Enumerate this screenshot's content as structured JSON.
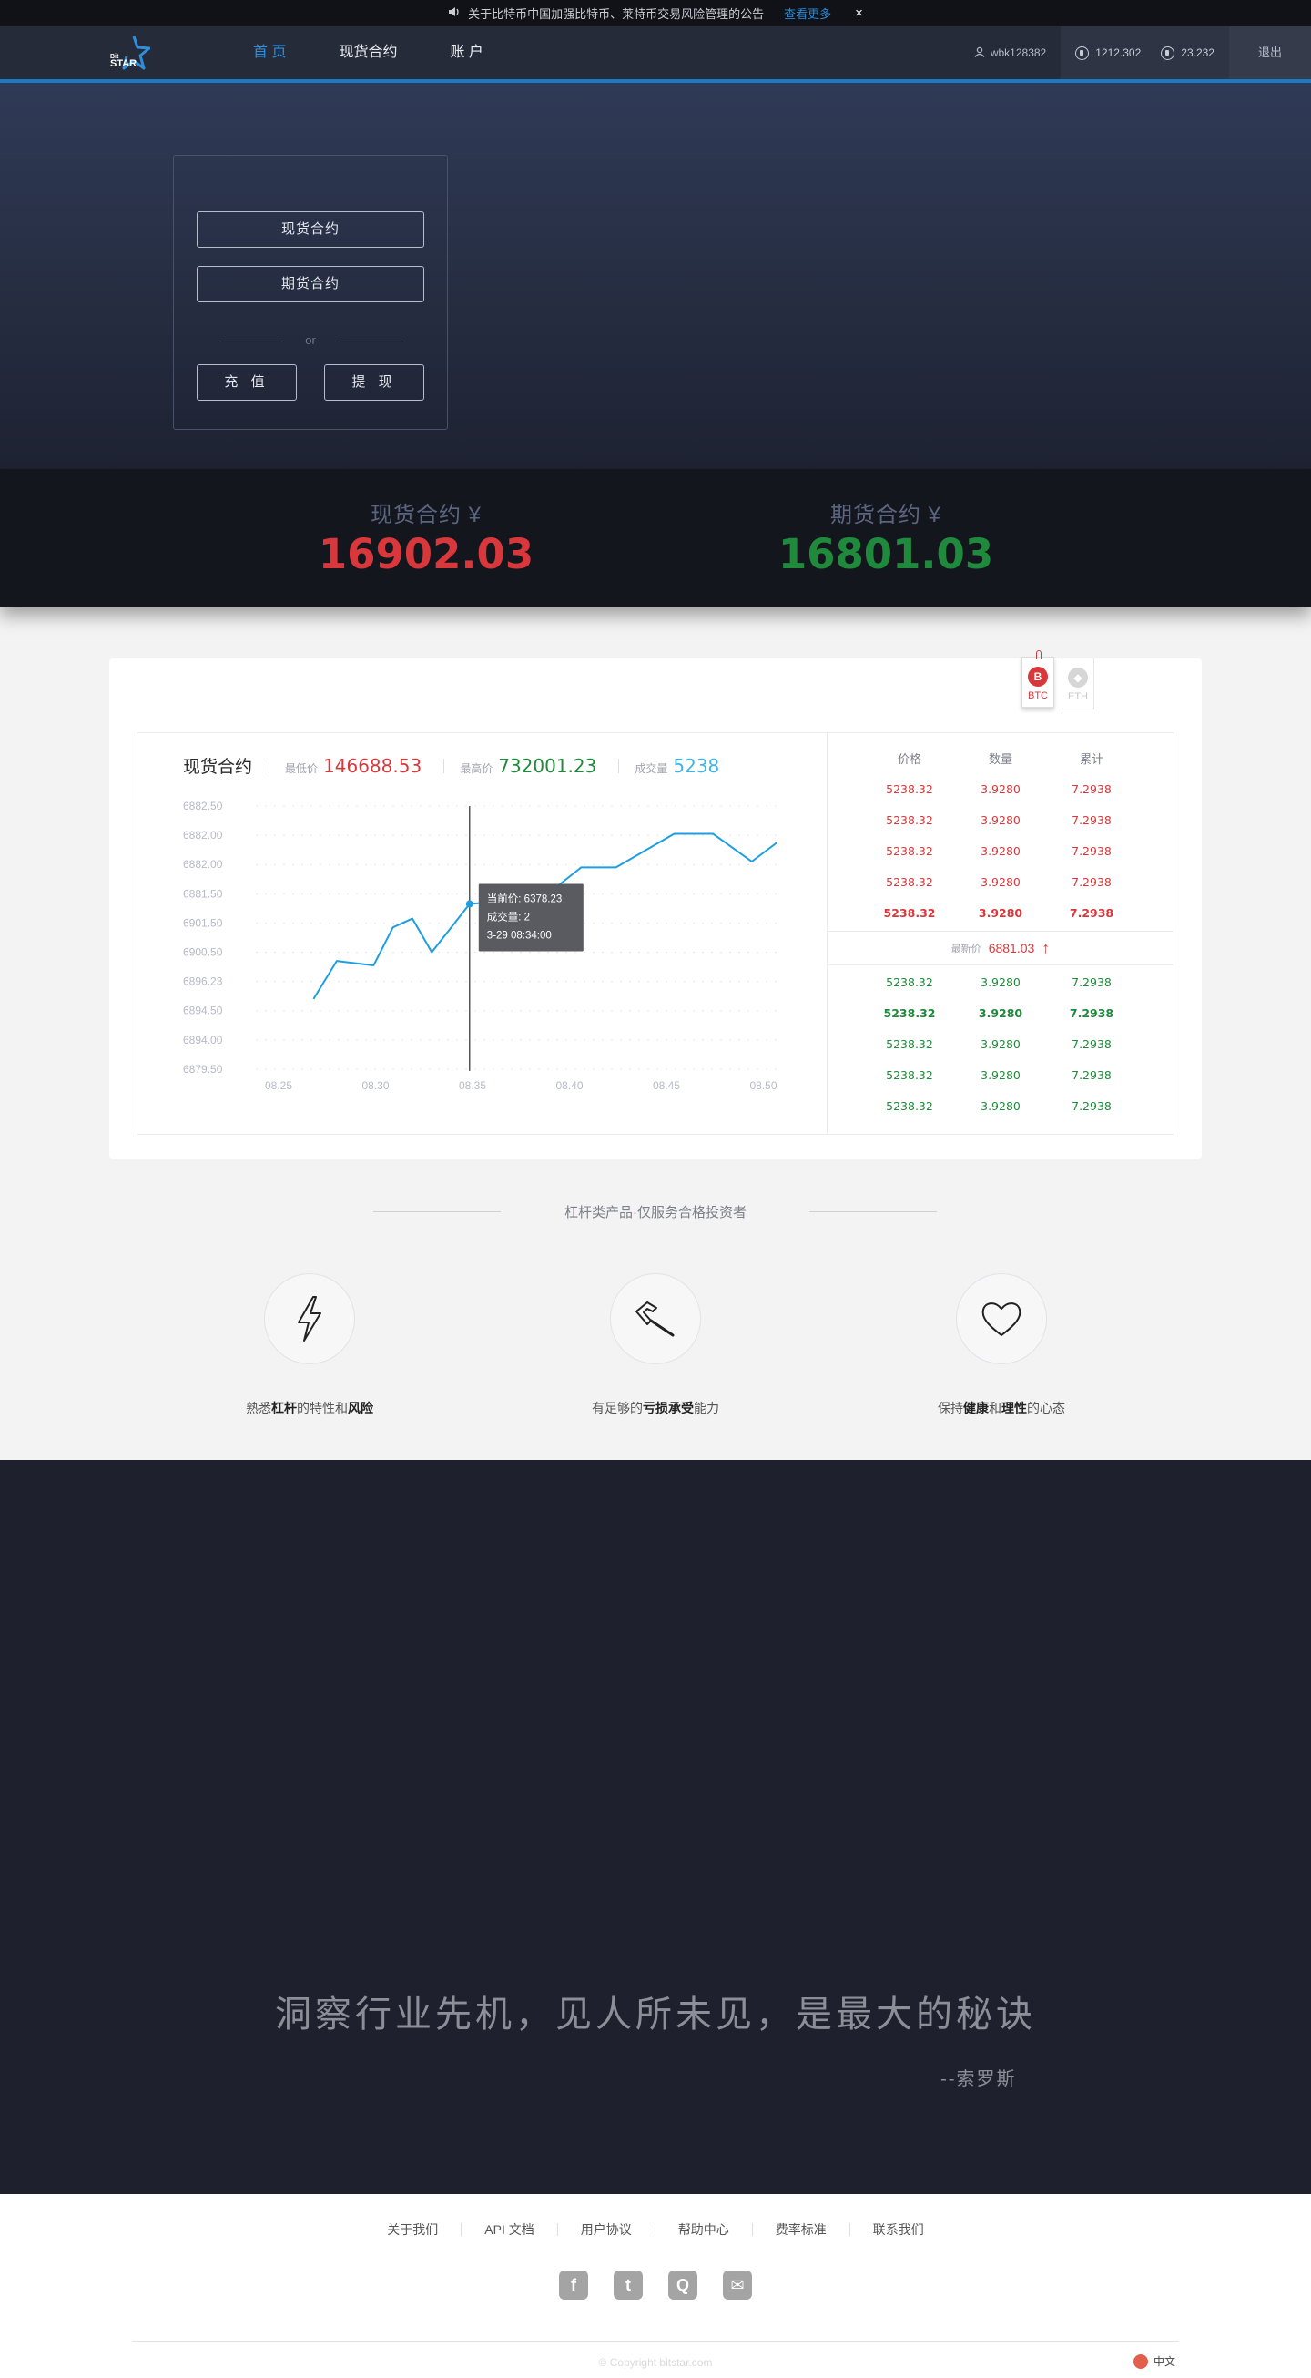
{
  "notice": {
    "text": "关于比特币中国加强比特币、莱特币交易风险管理的公告",
    "more": "查看更多",
    "close": "×"
  },
  "nav": {
    "logo_text": "STAR",
    "logo_sup": "Bit",
    "items": [
      {
        "label": "首 页",
        "active": true
      },
      {
        "label": "现货合约",
        "active": false
      },
      {
        "label": "账 户",
        "active": false
      }
    ],
    "username": "wbk128382",
    "btc_balance": "1212.302",
    "eth_balance": "23.232",
    "logout": "退出"
  },
  "hero": {
    "spot_button": "现货合约",
    "futures_button": "期货合约",
    "or": "or",
    "deposit_button": "充 值",
    "withdraw_button": "提 现"
  },
  "priceband": {
    "spot_label": "现货合约 ¥",
    "spot_value": "16902.03",
    "futures_label": "期货合约 ¥",
    "futures_value": "16801.03"
  },
  "market": {
    "coin_tabs": [
      {
        "label": "BTC",
        "icon": "B"
      },
      {
        "label": "ETH",
        "icon": "◆"
      }
    ],
    "title": "现货合约",
    "low_label": "最低价",
    "low_value": "146688.53",
    "high_label": "最高价",
    "high_value": "732001.23",
    "volume_label": "成交量",
    "volume_value": "5238",
    "tooltip": {
      "price_label": "当前价:",
      "price": "6378.23",
      "volume_label": "成交量:",
      "volume": "2",
      "time": "3-29  08:34:00"
    },
    "book_headers": [
      "价格",
      "数量",
      "累计"
    ],
    "asks": [
      [
        "5238.32",
        "3.9280",
        "7.2938"
      ],
      [
        "5238.32",
        "3.9280",
        "7.2938"
      ],
      [
        "5238.32",
        "3.9280",
        "7.2938"
      ],
      [
        "5238.32",
        "3.9280",
        "7.2938"
      ],
      [
        "5238.32",
        "3.9280",
        "7.2938"
      ]
    ],
    "last_label": "最新价",
    "last_value": "6881.03",
    "bids": [
      [
        "5238.32",
        "3.9280",
        "7.2938"
      ],
      [
        "5238.32",
        "3.9280",
        "7.2938"
      ],
      [
        "5238.32",
        "3.9280",
        "7.2938"
      ],
      [
        "5238.32",
        "3.9280",
        "7.2938"
      ],
      [
        "5238.32",
        "3.9280",
        "7.2938"
      ]
    ]
  },
  "chart_data": {
    "type": "line",
    "title": "",
    "xlabel": "",
    "ylabel": "",
    "x_ticks": [
      "08.25",
      "08.30",
      "08.35",
      "08.40",
      "08.45",
      "08.50"
    ],
    "y_ticks": [
      "6882.50",
      "6882.00",
      "6882.00",
      "6881.50",
      "6901.50",
      "6900.50",
      "6896.23",
      "6894.50",
      "6894.00",
      "6879.50"
    ],
    "y_tick_positions": [
      0,
      1,
      2,
      3,
      4,
      5,
      6,
      7,
      8,
      9
    ],
    "x_tick_positions": [
      0,
      5,
      10,
      15,
      20,
      25
    ],
    "series": [
      {
        "values": [
          {
            "x": 1.8,
            "y": 6.6
          },
          {
            "x": 3.0,
            "y": 5.3
          },
          {
            "x": 4.9,
            "y": 5.45
          },
          {
            "x": 5.9,
            "y": 4.15
          },
          {
            "x": 6.9,
            "y": 3.85
          },
          {
            "x": 7.9,
            "y": 5.0
          },
          {
            "x": 9.85,
            "y": 3.35
          },
          {
            "x": 13.6,
            "y": 3.15
          },
          {
            "x": 15.6,
            "y": 2.1
          },
          {
            "x": 17.4,
            "y": 2.1
          },
          {
            "x": 20.4,
            "y": 0.95
          },
          {
            "x": 22.4,
            "y": 0.95
          },
          {
            "x": 24.4,
            "y": 1.9
          },
          {
            "x": 25.7,
            "y": 1.25
          }
        ]
      }
    ],
    "crosshair_x": 9.85,
    "grid": true,
    "color": "#1d9ee1"
  },
  "features": {
    "divider": "杠杆类产品·仅服务合格投资者",
    "items": [
      {
        "icon": "lightning-icon",
        "pre": "熟悉",
        "b1": "杠杆",
        "mid": "的特性和",
        "b2": "风险",
        "post": ""
      },
      {
        "icon": "hammer-icon",
        "pre": "有足够的",
        "b1": "亏损承受",
        "mid": "能力",
        "b2": "",
        "post": ""
      },
      {
        "icon": "heart-icon",
        "pre": "保持",
        "b1": "健康",
        "mid": "和",
        "b2": "理性",
        "post": "的心态"
      }
    ]
  },
  "quote": {
    "text": "洞察行业先机，见人所未见，是最大的秘诀",
    "author": "--索罗斯"
  },
  "footer": {
    "links": [
      "关于我们",
      "API 文档",
      "用户协议",
      "帮助中心",
      "费率标准",
      "联系我们"
    ],
    "social": [
      {
        "name": "facebook-icon",
        "glyph": "f"
      },
      {
        "name": "twitter-icon",
        "glyph": "t"
      },
      {
        "name": "qq-group-icon",
        "glyph": "Q"
      },
      {
        "name": "mail-icon",
        "glyph": "✉"
      }
    ],
    "copyright": "© Copyright   bitstar.com",
    "language": "中文"
  },
  "colors": {
    "accent": "#1d79c5",
    "red": "#d8383b",
    "green": "#1f8a3b",
    "dark": "#1f202d"
  }
}
